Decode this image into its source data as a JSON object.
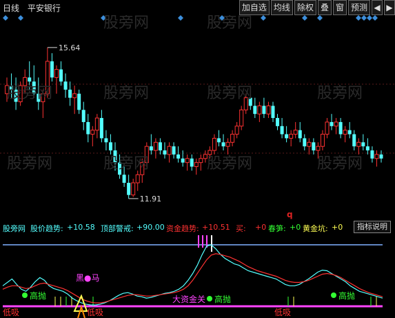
{
  "toolbar": {
    "period": "日线",
    "stock": "平安银行",
    "buttons": [
      "加自选",
      "均线",
      "除权",
      "叠",
      "窗",
      "预测"
    ],
    "arrow_left": "◀",
    "arrow_right": "▶"
  },
  "chart_data": [
    {
      "type": "candlestick",
      "title": "",
      "ylim": [
        11.5,
        16.2
      ],
      "annotations": {
        "high": "15.64",
        "low": "11.91"
      },
      "colors": {
        "up": "#ff3232",
        "down": "#54ffff"
      },
      "candles": [
        [
          14.5,
          14.9,
          14.3,
          14.7
        ],
        [
          14.7,
          15.0,
          14.4,
          14.6
        ],
        [
          14.6,
          14.9,
          14.1,
          14.3
        ],
        [
          14.3,
          14.8,
          14.2,
          14.7
        ],
        [
          14.7,
          15.1,
          14.5,
          14.9
        ],
        [
          14.9,
          15.3,
          14.6,
          14.8
        ],
        [
          14.8,
          15.2,
          14.4,
          14.5
        ],
        [
          14.5,
          14.9,
          14.1,
          14.3
        ],
        [
          14.3,
          14.6,
          13.9,
          14.5
        ],
        [
          14.5,
          15.64,
          14.4,
          15.3
        ],
        [
          15.3,
          15.5,
          14.8,
          14.9
        ],
        [
          14.9,
          15.2,
          14.5,
          15.1
        ],
        [
          15.1,
          15.3,
          14.7,
          14.8
        ],
        [
          14.8,
          15.0,
          14.4,
          14.6
        ],
        [
          14.6,
          14.8,
          14.2,
          14.4
        ],
        [
          14.4,
          14.7,
          14.0,
          14.5
        ],
        [
          14.5,
          14.6,
          14.0,
          14.1
        ],
        [
          14.1,
          14.3,
          13.6,
          13.8
        ],
        [
          13.8,
          14.0,
          13.3,
          13.5
        ],
        [
          13.5,
          13.7,
          13.2,
          13.6
        ],
        [
          13.6,
          14.0,
          13.4,
          13.9
        ],
        [
          13.9,
          14.1,
          13.3,
          13.4
        ],
        [
          13.4,
          13.6,
          13.1,
          13.3
        ],
        [
          13.3,
          13.5,
          13.0,
          13.1
        ],
        [
          13.1,
          13.3,
          12.6,
          12.8
        ],
        [
          12.8,
          13.0,
          12.4,
          12.5
        ],
        [
          12.5,
          12.7,
          12.2,
          12.3
        ],
        [
          12.3,
          12.5,
          11.91,
          12.0
        ],
        [
          12.0,
          12.4,
          11.95,
          12.3
        ],
        [
          12.3,
          12.6,
          12.1,
          12.5
        ],
        [
          12.5,
          12.9,
          12.3,
          12.8
        ],
        [
          12.8,
          13.3,
          12.7,
          13.2
        ],
        [
          13.2,
          13.5,
          13.0,
          13.1
        ],
        [
          13.1,
          13.4,
          12.9,
          13.3
        ],
        [
          13.3,
          13.4,
          13.0,
          13.1
        ],
        [
          13.1,
          13.3,
          12.9,
          13.0
        ],
        [
          13.0,
          13.3,
          12.8,
          13.2
        ],
        [
          13.2,
          13.3,
          12.9,
          13.0
        ],
        [
          13.0,
          13.2,
          12.8,
          12.9
        ],
        [
          12.9,
          13.1,
          12.7,
          12.8
        ],
        [
          12.8,
          13.0,
          12.6,
          12.9
        ],
        [
          12.9,
          13.0,
          12.6,
          12.7
        ],
        [
          12.7,
          12.9,
          12.5,
          12.8
        ],
        [
          12.8,
          13.0,
          12.6,
          12.9
        ],
        [
          12.9,
          13.1,
          12.8,
          13.0
        ],
        [
          13.0,
          13.2,
          12.9,
          13.1
        ],
        [
          13.1,
          13.5,
          13.0,
          13.4
        ],
        [
          13.4,
          13.6,
          13.2,
          13.3
        ],
        [
          13.3,
          13.5,
          13.1,
          13.2
        ],
        [
          13.2,
          13.4,
          13.0,
          13.3
        ],
        [
          13.3,
          13.6,
          13.2,
          13.5
        ],
        [
          13.5,
          13.8,
          13.4,
          13.7
        ],
        [
          13.7,
          14.2,
          13.6,
          14.1
        ],
        [
          14.1,
          14.5,
          14.0,
          14.4
        ],
        [
          14.4,
          14.6,
          14.1,
          14.2
        ],
        [
          14.2,
          14.4,
          13.9,
          14.0
        ],
        [
          14.0,
          14.3,
          13.8,
          14.2
        ],
        [
          14.2,
          14.4,
          13.9,
          14.0
        ],
        [
          14.0,
          14.3,
          13.9,
          14.2
        ],
        [
          14.2,
          14.3,
          13.8,
          13.9
        ],
        [
          13.9,
          14.0,
          13.6,
          13.7
        ],
        [
          13.7,
          13.9,
          13.4,
          13.5
        ],
        [
          13.5,
          13.7,
          13.3,
          13.4
        ],
        [
          13.4,
          13.6,
          13.2,
          13.5
        ],
        [
          13.5,
          13.8,
          13.4,
          13.6
        ],
        [
          13.6,
          13.8,
          13.3,
          13.4
        ],
        [
          13.4,
          13.5,
          13.1,
          13.2
        ],
        [
          13.2,
          13.4,
          13.0,
          13.3
        ],
        [
          13.3,
          13.4,
          13.0,
          13.1
        ],
        [
          13.1,
          13.3,
          12.9,
          13.2
        ],
        [
          13.2,
          13.6,
          13.1,
          13.5
        ],
        [
          13.5,
          13.9,
          13.4,
          13.8
        ],
        [
          13.8,
          14.0,
          13.6,
          13.7
        ],
        [
          13.7,
          13.9,
          13.5,
          13.8
        ],
        [
          13.8,
          13.9,
          13.4,
          13.5
        ],
        [
          13.5,
          13.7,
          13.3,
          13.6
        ],
        [
          13.6,
          13.8,
          13.4,
          13.5
        ],
        [
          13.5,
          13.6,
          13.1,
          13.2
        ],
        [
          13.2,
          13.4,
          13.0,
          13.3
        ],
        [
          13.3,
          13.5,
          13.1,
          13.2
        ],
        [
          13.2,
          13.4,
          13.0,
          13.1
        ],
        [
          13.1,
          13.2,
          12.8,
          12.9
        ],
        [
          12.9,
          13.1,
          12.7,
          13.0
        ],
        [
          13.0,
          13.1,
          12.8,
          12.9
        ]
      ]
    },
    {
      "type": "line",
      "title": "",
      "legend": [
        {
          "label": "股价趋势:",
          "value": "+10.58",
          "color": "#54ffff"
        },
        {
          "label": "顶部警戒:",
          "value": "+90.00",
          "color": "#54ffff"
        },
        {
          "label": "资金趋势:",
          "value": "+10.51",
          "color": "#ff3232"
        },
        {
          "label": "买:",
          "value": "+0",
          "color": "#ff3232"
        },
        {
          "label": "春笋:",
          "value": "+0",
          "color": "#33ff33"
        },
        {
          "label": "黄金坑:",
          "value": "+0",
          "color": "#ffff54"
        }
      ],
      "help_label": "指标说明",
      "watermark": "股旁网",
      "ylim": [
        -5,
        100
      ],
      "warning_level": 90,
      "series": [
        {
          "name": "股价趋势",
          "color": "#54ffff",
          "values": [
            30,
            35,
            40,
            32,
            25,
            22,
            28,
            36,
            42,
            38,
            30,
            26,
            24,
            22,
            18,
            12,
            8,
            5,
            3,
            2,
            2,
            3,
            5,
            8,
            12,
            16,
            19,
            20,
            18,
            15,
            14,
            12,
            13,
            15,
            17,
            19,
            20,
            22,
            25,
            30,
            38,
            48,
            60,
            75,
            88,
            90,
            84,
            76,
            70,
            66,
            62,
            60,
            56,
            52,
            50,
            48,
            46,
            44,
            42,
            40,
            36,
            32,
            30,
            30,
            32,
            36,
            40,
            45,
            50,
            53,
            52,
            48,
            44,
            40,
            36,
            30,
            26,
            22,
            20,
            18,
            16,
            14,
            12
          ]
        },
        {
          "name": "资金趋势",
          "color": "#ff3232",
          "values": [
            25,
            28,
            30,
            30,
            28,
            26,
            27,
            30,
            33,
            34,
            32,
            30,
            28,
            26,
            23,
            19,
            15,
            11,
            8,
            6,
            5,
            5,
            6,
            8,
            10,
            12,
            14,
            16,
            17,
            17,
            16,
            15,
            15,
            16,
            17,
            18,
            19,
            20,
            22,
            25,
            30,
            38,
            48,
            58,
            68,
            75,
            77,
            76,
            74,
            72,
            69,
            66,
            62,
            58,
            55,
            52,
            50,
            48,
            46,
            44,
            41,
            38,
            36,
            35,
            35,
            36,
            38,
            41,
            44,
            47,
            48,
            47,
            45,
            42,
            38,
            34,
            30,
            26,
            23,
            20,
            18,
            16,
            14
          ]
        }
      ],
      "markers": [
        {
          "text": "黑●马",
          "color": "#ff44ff"
        },
        {
          "text": "大资金关",
          "color": "#ff44ff"
        },
        {
          "text": "高抛",
          "color": "#33ff33"
        },
        {
          "text": "高抛",
          "color": "#33ff33"
        },
        {
          "text": "高抛",
          "color": "#33ff33"
        },
        {
          "text": "低吸",
          "color": "#ff3232"
        },
        {
          "text": "低吸",
          "color": "#ff3232"
        },
        {
          "text": "低吸",
          "color": "#ff3232"
        }
      ]
    }
  ],
  "misc": {
    "red_q": "q"
  }
}
